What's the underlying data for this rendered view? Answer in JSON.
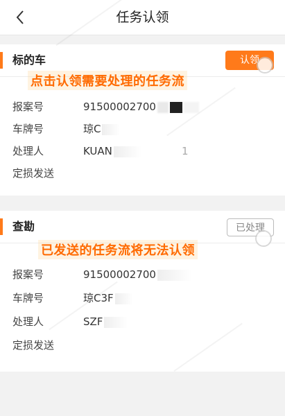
{
  "nav": {
    "title": "任务认领"
  },
  "cards": [
    {
      "title": "标的车",
      "button_label": "认领",
      "banner": "点击认领需要处理的任务流",
      "fields": [
        {
          "label": "报案号",
          "value": "91500002700"
        },
        {
          "label": "车牌号",
          "value": "琼C"
        },
        {
          "label": "处理人",
          "value": "KUAN",
          "tail": "1"
        },
        {
          "label": "定损发送",
          "value": ""
        }
      ]
    },
    {
      "title": "查勘",
      "button_label": "已处理",
      "banner": "已发送的任务流将无法认领",
      "fields": [
        {
          "label": "报案号",
          "value": "91500002700"
        },
        {
          "label": "车牌号",
          "value": "琼C3F"
        },
        {
          "label": "处理人",
          "value": "SZF"
        },
        {
          "label": "定损发送",
          "value": ""
        }
      ]
    }
  ],
  "colors": {
    "accent": "#ff7a1a",
    "banner_text": "#ff6a00",
    "background": "#f2f2f2"
  },
  "icons": {
    "back": "chevron-left-icon",
    "tap": "tap-indicator-icon"
  }
}
